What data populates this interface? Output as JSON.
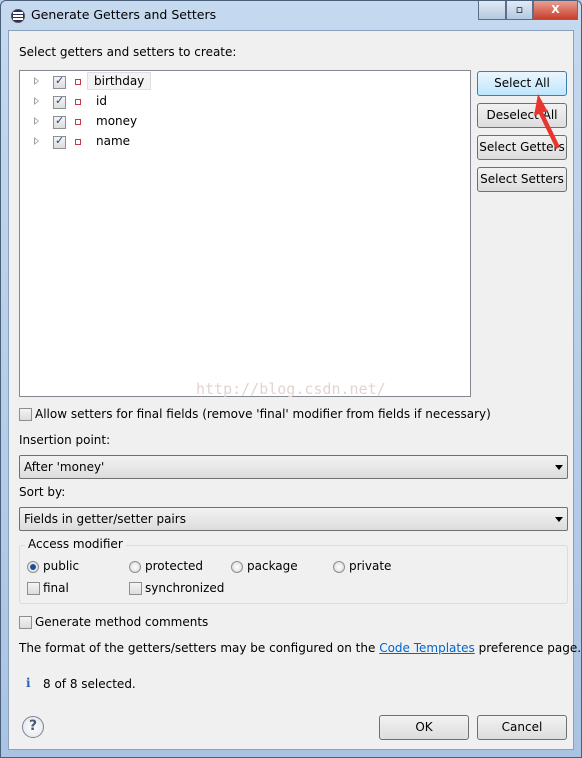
{
  "window": {
    "title": "Generate Getters and Setters",
    "minimize": "—",
    "maximize": "▫",
    "close": "X"
  },
  "prompt": "Select getters and setters to create:",
  "fields": [
    {
      "name": "birthday",
      "checked": true
    },
    {
      "name": "id",
      "checked": true
    },
    {
      "name": "money",
      "checked": true
    },
    {
      "name": "name",
      "checked": true
    }
  ],
  "buttons": {
    "select_all": "Select All",
    "deselect_all": "Deselect All",
    "select_getters": "Select Getters",
    "select_setters": "Select Setters",
    "ok": "OK",
    "cancel": "Cancel"
  },
  "allow_final": {
    "label": "Allow setters for final fields (remove 'final' modifier from fields if necessary)",
    "checked": false
  },
  "insertion": {
    "label": "Insertion point:",
    "value": "After 'money'"
  },
  "sort": {
    "label": "Sort by:",
    "value": "Fields in getter/setter pairs"
  },
  "access": {
    "legend": "Access modifier",
    "options": [
      "public",
      "protected",
      "package",
      "private"
    ],
    "selected": "public",
    "final": "final",
    "synchronized": "synchronized"
  },
  "comments": {
    "label": "Generate method comments",
    "checked": false
  },
  "format": {
    "before": "The format of the getters/setters may be configured on the",
    "link": "Code Templates",
    "after": "preference page."
  },
  "status": {
    "icon": "info-icon",
    "text": "8 of 8 selected."
  },
  "watermark": "http://blog.csdn.net/",
  "colors": {
    "link": "#0066cc",
    "arrow": "#e8362f"
  }
}
